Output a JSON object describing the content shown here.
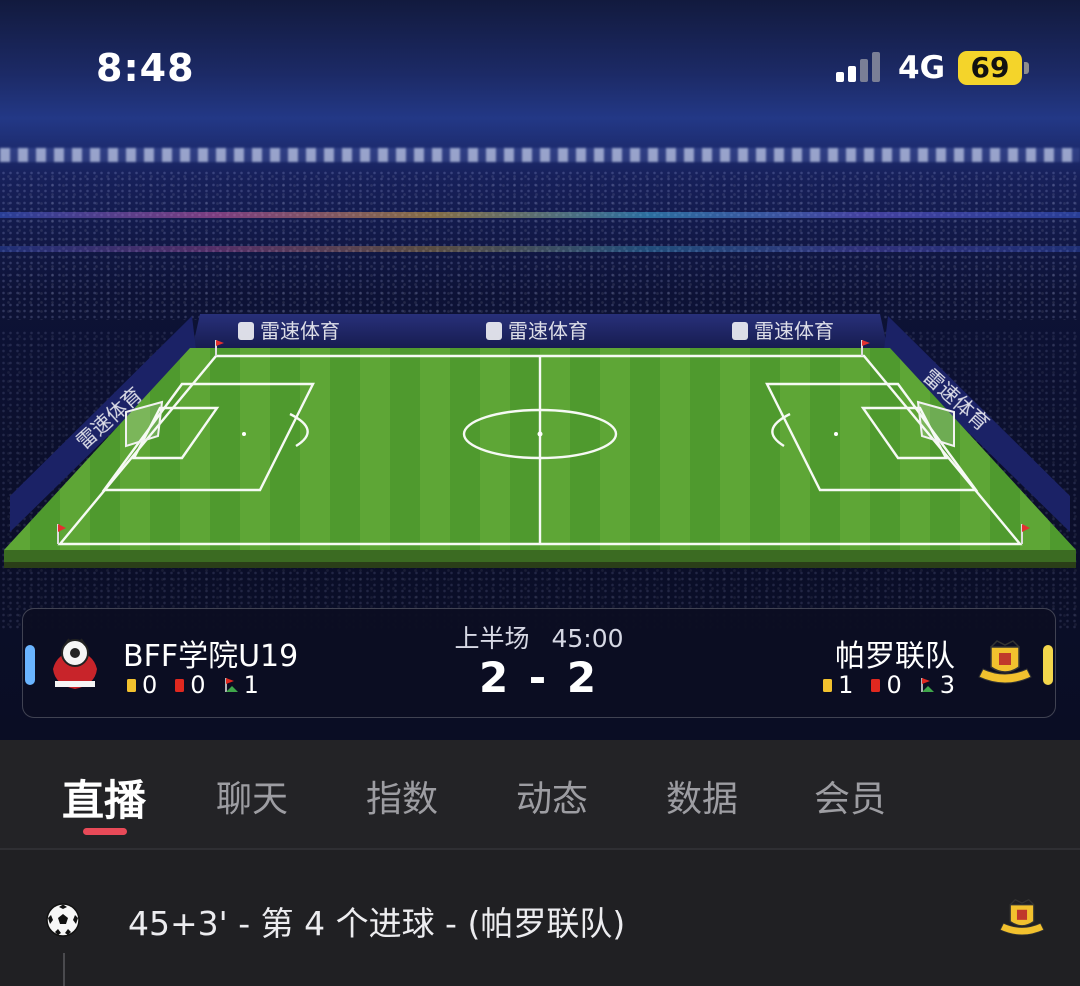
{
  "status_bar": {
    "time": "8:48",
    "network": "4G",
    "battery": "69"
  },
  "stadium": {
    "ad_board_text": "雷速体育"
  },
  "match": {
    "period": "上半场",
    "clock": "45:00",
    "score": "2 - 2",
    "home": {
      "name": "BFF学院U19",
      "yellow_cards": "0",
      "red_cards": "0",
      "corners": "1",
      "color": "#6ab4ff"
    },
    "away": {
      "name": "帕罗联队",
      "yellow_cards": "1",
      "red_cards": "0",
      "corners": "3",
      "color": "#f3d64c"
    }
  },
  "tabs": [
    {
      "label": "直播",
      "active": true
    },
    {
      "label": "聊天"
    },
    {
      "label": "指数"
    },
    {
      "label": "动态"
    },
    {
      "label": "数据"
    },
    {
      "label": "会员"
    }
  ],
  "feed": {
    "events": [
      {
        "text": "45+3' - 第 4 个进球 - (帕罗联队)",
        "icon": "soccer-ball-icon"
      }
    ]
  },
  "colors": {
    "accent": "#e84a58",
    "pitch_green": "#4f9a2e",
    "yellow_card": "#f2c12e",
    "red_card": "#e0281f"
  }
}
